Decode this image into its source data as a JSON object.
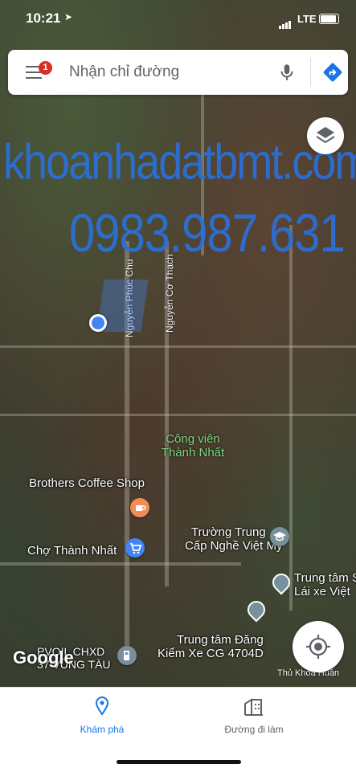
{
  "status_bar": {
    "time": "10:21",
    "network": "LTE"
  },
  "search": {
    "placeholder": "Nhận chỉ đường",
    "notification_count": "1"
  },
  "watermark": {
    "site": "khoanhadatbmt.com",
    "phone": "0983.987.631"
  },
  "streets": [
    {
      "name": "Nguyễn Phúc Chu"
    },
    {
      "name": "Nguyễn Cơ Thạch"
    },
    {
      "name": "Thủ Khoa Huân"
    }
  ],
  "places": {
    "park": {
      "line1": "Công viên",
      "line2": "Thành Nhất"
    },
    "coffee": "Brothers Coffee Shop",
    "market": "Chợ Thành Nhất",
    "school": {
      "line1": "Trường Trung",
      "line2": "Cấp Nghề Việt Mỹ"
    },
    "driving": {
      "line1": "Trung tâm S",
      "line2": "Lái xe Việt"
    },
    "inspection": {
      "line1": "Trung tâm Đăng",
      "line2": "Kiểm Xe CG 4704D"
    },
    "gas": {
      "line1": "PVOIL CHXD",
      "line2": "37 VŨNG TÀU"
    }
  },
  "logo": "Google",
  "bottom_nav": {
    "explore": "Khám phá",
    "commute": "Đường đi làm"
  },
  "colors": {
    "accent": "#1a73e8",
    "watermark": "#2b6fd6",
    "badge": "#d93025"
  }
}
